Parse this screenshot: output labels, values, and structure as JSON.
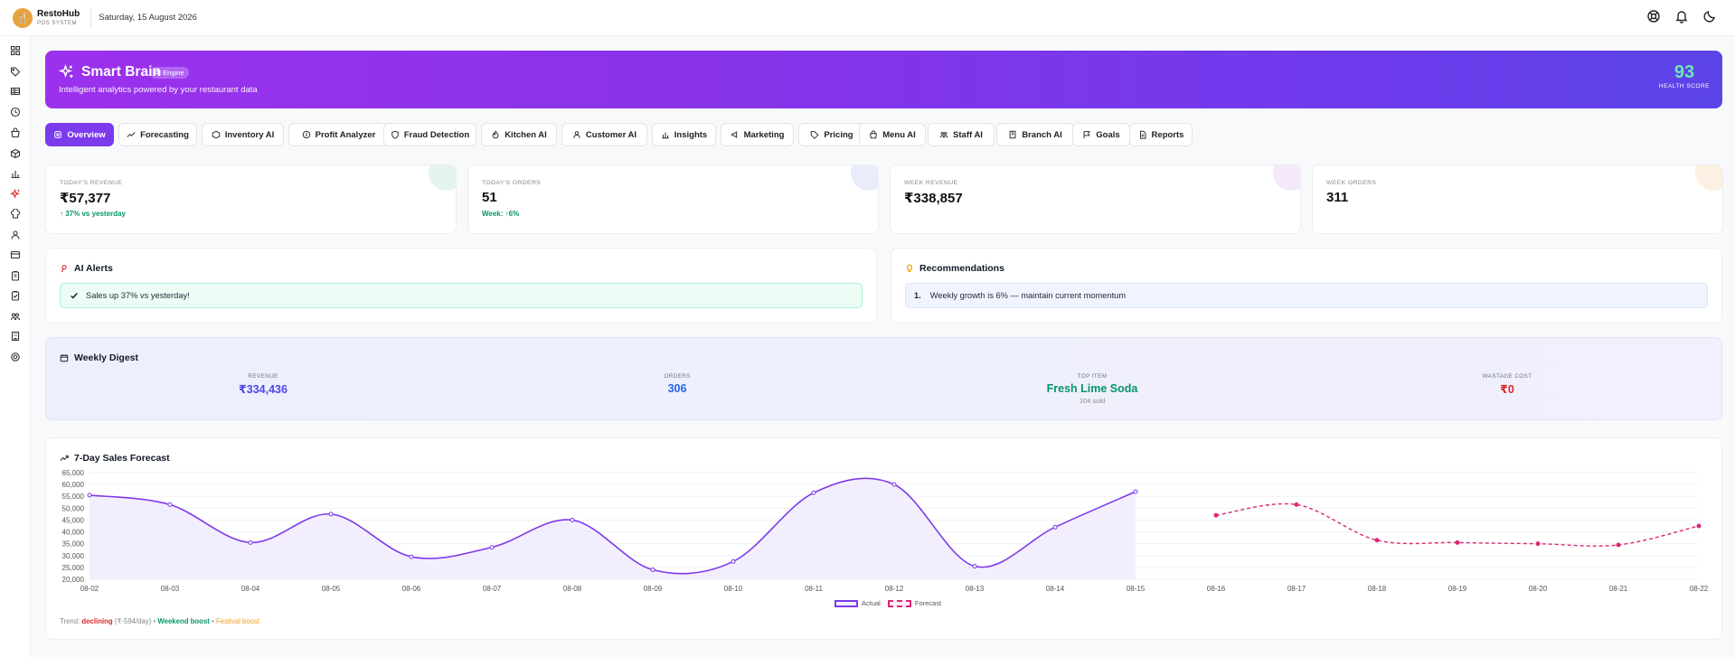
{
  "app": {
    "name": "RestoHub",
    "subtitle": "POS SYSTEM",
    "date": "Saturday, 15 August 2026"
  },
  "topbar": {
    "icons": [
      "help-icon",
      "bell-icon",
      "moon-icon"
    ]
  },
  "sidebar": {
    "icons": [
      "grid-icon",
      "tag-icon",
      "table-icon",
      "clock-icon",
      "bag-icon",
      "box-icon",
      "chart-icon",
      "sparkle-icon",
      "chef-icon",
      "users-icon",
      "card-icon",
      "clipboard-icon",
      "clipboard-check-icon",
      "team-icon",
      "building-icon",
      "settings-icon"
    ],
    "active_index": 7,
    "accent": "#dc2626"
  },
  "hero": {
    "title": "Smart Brain",
    "badge": "AI Engine",
    "subtitle": "Intelligent analytics powered by your restaurant data",
    "score": "93",
    "score_label": "HEALTH SCORE"
  },
  "tabs": [
    {
      "label": "Overview",
      "icon": "overview-icon"
    },
    {
      "label": "Forecasting",
      "icon": "trend-icon"
    },
    {
      "label": "Inventory AI",
      "icon": "box-icon"
    },
    {
      "label": "Profit Analyzer",
      "icon": "coin-icon"
    },
    {
      "label": "Fraud Detection",
      "icon": "shield-icon"
    },
    {
      "label": "Kitchen AI",
      "icon": "flame-icon"
    },
    {
      "label": "Customer AI",
      "icon": "user-icon"
    },
    {
      "label": "Insights",
      "icon": "bar-chart-icon"
    },
    {
      "label": "Marketing",
      "icon": "megaphone-icon"
    },
    {
      "label": "Pricing",
      "icon": "price-tag-icon"
    },
    {
      "label": "Menu AI",
      "icon": "menu-icon"
    },
    {
      "label": "Staff AI",
      "icon": "staff-icon"
    },
    {
      "label": "Branch AI",
      "icon": "branch-icon"
    },
    {
      "label": "Goals",
      "icon": "flag-icon"
    },
    {
      "label": "Reports",
      "icon": "report-icon"
    }
  ],
  "stats": [
    {
      "label": "TODAY'S REVENUE",
      "value": "₹57,377",
      "note": "↑ 37% vs yesterday",
      "blob": "#e3f5ec"
    },
    {
      "label": "TODAY'S ORDERS",
      "value": "51",
      "note": "Week: ↑6%",
      "blob": "#e8ecfb"
    },
    {
      "label": "WEEK REVENUE",
      "value": "₹338,857",
      "note": "",
      "blob": "#f3e9fb"
    },
    {
      "label": "WEEK ORDERS",
      "value": "311",
      "note": "",
      "blob": "#fcf0e2"
    }
  ],
  "alerts": {
    "title": "AI Alerts",
    "items": [
      "Sales up 37% vs yesterday!"
    ]
  },
  "recommendations": {
    "title": "Recommendations",
    "items": [
      {
        "num": "1.",
        "text": "Weekly growth is 6% — maintain current momentum"
      }
    ]
  },
  "digest": {
    "title": "Weekly Digest",
    "cols": [
      {
        "label": "REVENUE",
        "value": "₹334,436",
        "color": "#4f46e5",
        "sub": ""
      },
      {
        "label": "ORDERS",
        "value": "306",
        "color": "#2563eb",
        "sub": ""
      },
      {
        "label": "TOP ITEM",
        "value": "Fresh Lime Soda",
        "color": "#059669",
        "sub": "104 sold"
      },
      {
        "label": "WASTAGE COST",
        "value": "₹0",
        "color": "#dc2626",
        "sub": ""
      }
    ]
  },
  "forecast": {
    "title": "7-Day Sales Forecast",
    "trend_prefix": "Trend:",
    "trend_word": "declining",
    "trend_rate": "(₹-594/day)",
    "dot1": "•",
    "weekend": "Weekend boost",
    "dot2": "•",
    "festival": "Festival boost"
  },
  "chart_data": {
    "type": "line",
    "title": "7-Day Sales Forecast",
    "categories": [
      "08-02",
      "08-03",
      "08-04",
      "08-05",
      "08-06",
      "08-07",
      "08-08",
      "08-09",
      "08-10",
      "08-11",
      "08-12",
      "08-13",
      "08-14",
      "08-15",
      "08-16",
      "08-17",
      "08-18",
      "08-19",
      "08-20",
      "08-21",
      "08-22"
    ],
    "y_ticks": [
      "65,000",
      "60,000",
      "55,000",
      "50,000",
      "45,000",
      "40,000",
      "35,000",
      "30,000",
      "25,000",
      "20,000"
    ],
    "ylim": [
      20000,
      65000
    ],
    "grid": true,
    "series": [
      {
        "name": "Actual",
        "color": "#7c3aed",
        "start_index": 0,
        "values": [
          55500,
          51500,
          35500,
          47500,
          29500,
          33500,
          45000,
          24000,
          27500,
          56500,
          60000,
          25500,
          42000,
          57000
        ]
      },
      {
        "name": "Forecast",
        "color": "#db2777",
        "start_index": 14,
        "values": [
          47000,
          51500,
          36500,
          35500,
          35000,
          34500,
          42500
        ]
      }
    ]
  }
}
